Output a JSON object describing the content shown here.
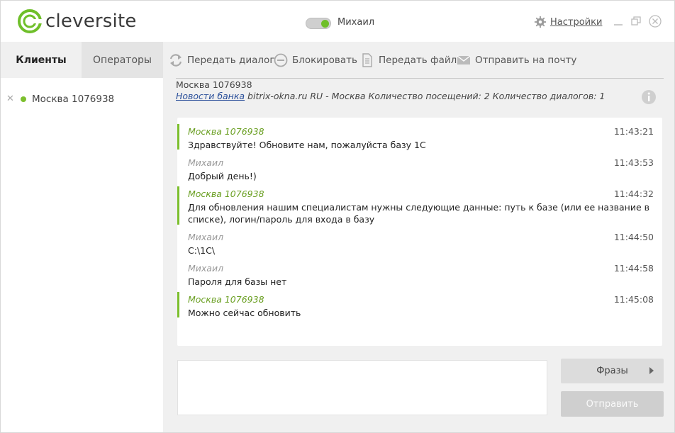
{
  "app": {
    "brand": "cleversite",
    "brand_color": "#6fbf2a"
  },
  "header": {
    "operator_name": "Михаил",
    "status_toggle": "on",
    "settings_label": "Настройки",
    "window_buttons": [
      "minimize-icon",
      "restore-icon",
      "close-icon"
    ]
  },
  "sidebar": {
    "tabs": [
      {
        "label": "Клиенты",
        "active": true
      },
      {
        "label": "Операторы",
        "active": false
      }
    ],
    "clients": [
      {
        "name": "Москва 1076938",
        "status": "online"
      }
    ]
  },
  "toolbar": {
    "items": [
      {
        "label": "Передать диалог",
        "icon": "transfer-icon"
      },
      {
        "label": "Блокировать",
        "icon": "block-icon"
      },
      {
        "label": "Передать файл",
        "icon": "file-icon"
      },
      {
        "label": "Отправить на почту",
        "icon": "mail-icon"
      }
    ]
  },
  "visitor": {
    "name": "Москва 1076938",
    "link_text": "Новости банка",
    "details": " bitrix-okna.ru RU - Москва Количество посещений: 2 Количество диалогов: 1"
  },
  "messages": [
    {
      "author": "Москва 1076938",
      "role": "client",
      "time": "11:43:21",
      "text": "Здравствуйте! Обновите нам, пожалуйста базу 1С"
    },
    {
      "author": "Михаил",
      "role": "operator",
      "time": "11:43:53",
      "text": "Добрый день!)"
    },
    {
      "author": "Москва 1076938",
      "role": "client",
      "time": "11:44:32",
      "text": "Для обновления нашим специалистам нужны следующие данные: путь к базе (или ее название в списке), логин/пароль для входа в базу"
    },
    {
      "author": "Михаил",
      "role": "operator",
      "time": "11:44:50",
      "text": "C:\\1C\\"
    },
    {
      "author": "Михаил",
      "role": "operator",
      "time": "11:44:58",
      "text": "Пароля для базы нет"
    },
    {
      "author": "Москва 1076938",
      "role": "client",
      "time": "11:45:08",
      "text": "Можно сейчас обновить"
    }
  ],
  "composer": {
    "input_value": "",
    "phrases_label": "Фразы",
    "send_label": "Отправить"
  }
}
